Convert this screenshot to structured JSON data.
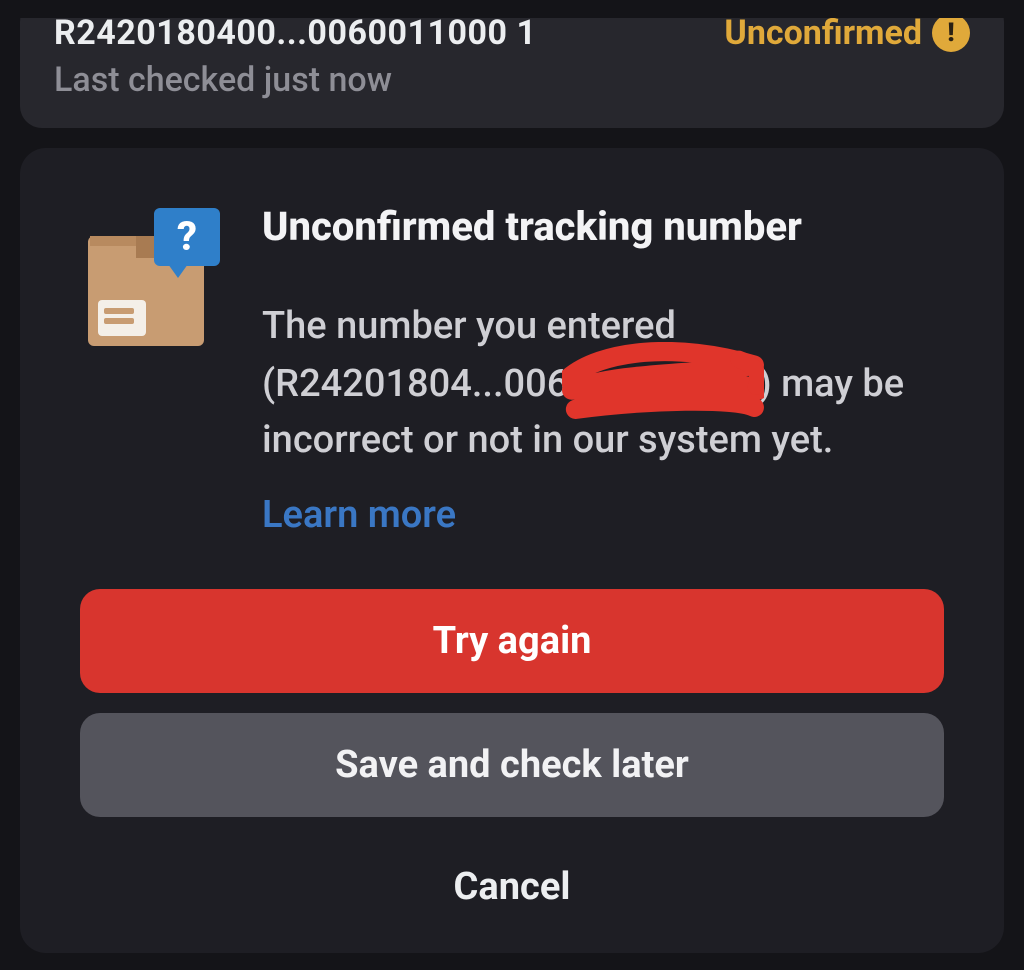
{
  "top": {
    "tracking_masked": "R2420180400...0060011000 1",
    "status_label": "Unconfirmed",
    "subtext": "Last checked just now"
  },
  "dialog": {
    "title": "Unconfirmed tracking number",
    "body_pre": "The number you entered (",
    "tracking_partial": "R24201804...006",
    "body_post": " may be incorrect or not in our system yet.",
    "learn_more": "Learn more"
  },
  "buttons": {
    "primary": "Try again",
    "secondary": "Save and check later",
    "cancel": "Cancel"
  },
  "icons": {
    "package_question": "package-question-icon",
    "warning_badge": "!"
  }
}
